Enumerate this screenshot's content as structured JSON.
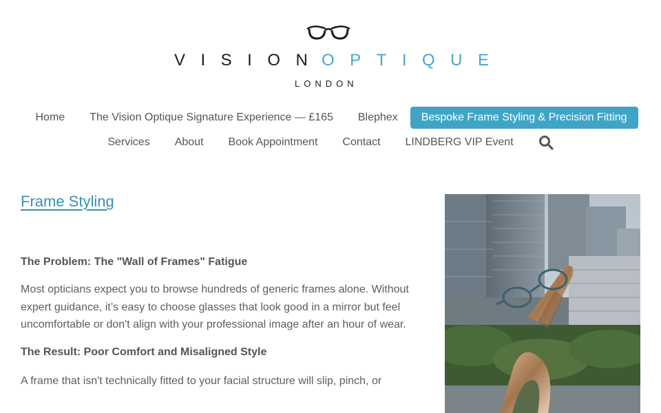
{
  "logo": {
    "word_dark": "VISION",
    "word_accent": "OPTIQUE",
    "subtitle": "LONDON",
    "icon": "eyeglasses-icon",
    "accent_color": "#48a8c9"
  },
  "nav": {
    "row1": [
      {
        "label": "Home",
        "active": false
      },
      {
        "label": "The Vision Optique Signature Experience — £165",
        "active": false
      },
      {
        "label": "Blephex",
        "active": false
      },
      {
        "label": "Bespoke Frame Styling & Precision Fitting",
        "active": true
      }
    ],
    "row2": [
      {
        "label": "Services",
        "active": false
      },
      {
        "label": "About",
        "active": false
      },
      {
        "label": "Book Appointment",
        "active": false
      },
      {
        "label": "Contact",
        "active": false
      },
      {
        "label": "LINDBERG VIP Event",
        "active": false
      }
    ],
    "search_icon": "search-icon",
    "active_color": "#3fa5c7"
  },
  "main": {
    "title": "Frame Styling",
    "problem_heading": "The Problem: The \"Wall of Frames\" Fatigue",
    "problem_text": "Most opticians expect you to browse hundreds of generic frames alone. Without expert guidance, it’s easy to choose glasses that look good in a mirror but feel uncomfortable or don't align with your professional image after an hour of wear.",
    "result_heading": "The Result: Poor Comfort and Misaligned Style",
    "result_text": "A frame that isn't technically fitted to your facial structure will slip, pinch, or"
  }
}
